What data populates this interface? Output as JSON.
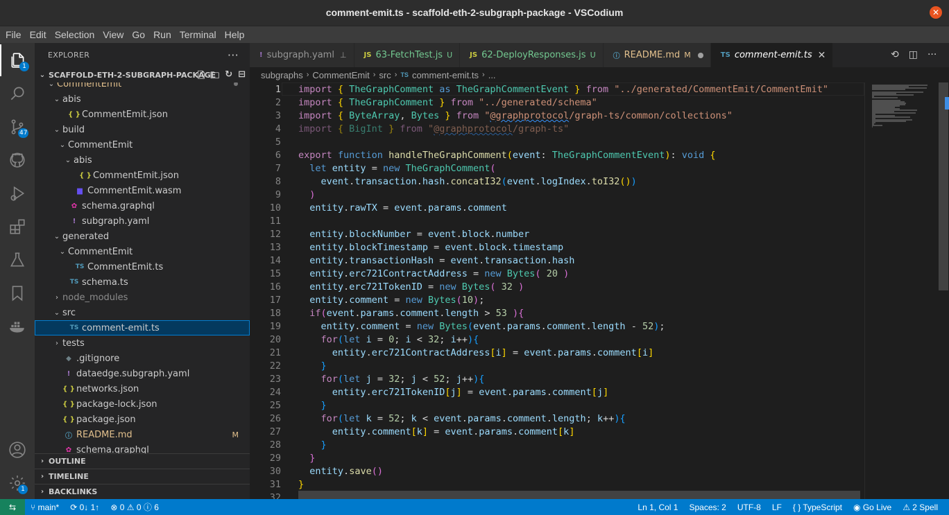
{
  "window": {
    "title": "comment-emit.ts - scaffold-eth-2-subgraph-package - VSCodium"
  },
  "menu": [
    "File",
    "Edit",
    "Selection",
    "View",
    "Go",
    "Run",
    "Terminal",
    "Help"
  ],
  "activity": {
    "explorer_badge": "1",
    "source_control_badge": "47",
    "settings_badge": "1"
  },
  "sidebar": {
    "header": "EXPLORER",
    "project": "SCAFFOLD-ETH-2-SUBGRAPH-PACKAGE",
    "tree": [
      {
        "label": "CommentEmit",
        "type": "folder-open",
        "depth": 1,
        "cls": "modified"
      },
      {
        "label": "abis",
        "type": "folder-open",
        "depth": 2
      },
      {
        "label": "CommentEmit.json",
        "type": "json",
        "depth": 3
      },
      {
        "label": "build",
        "type": "folder-open",
        "depth": 2
      },
      {
        "label": "CommentEmit",
        "type": "folder-open",
        "depth": 3
      },
      {
        "label": "abis",
        "type": "folder-open",
        "depth": 4
      },
      {
        "label": "CommentEmit.json",
        "type": "json",
        "depth": 5
      },
      {
        "label": "CommentEmit.wasm",
        "type": "wasm",
        "depth": 4
      },
      {
        "label": "schema.graphql",
        "type": "gql",
        "depth": 3
      },
      {
        "label": "subgraph.yaml",
        "type": "yaml",
        "depth": 3
      },
      {
        "label": "generated",
        "type": "folder-open",
        "depth": 2
      },
      {
        "label": "CommentEmit",
        "type": "folder-open",
        "depth": 3
      },
      {
        "label": "CommentEmit.ts",
        "type": "ts",
        "depth": 4
      },
      {
        "label": "schema.ts",
        "type": "ts",
        "depth": 3
      },
      {
        "label": "node_modules",
        "type": "folder-closed",
        "depth": 2,
        "cls": "dim"
      },
      {
        "label": "src",
        "type": "folder-open",
        "depth": 2
      },
      {
        "label": "comment-emit.ts",
        "type": "ts",
        "depth": 3,
        "selected": true
      },
      {
        "label": "tests",
        "type": "folder-closed",
        "depth": 2
      },
      {
        "label": ".gitignore",
        "type": "git",
        "depth": 2
      },
      {
        "label": "dataedge.subgraph.yaml",
        "type": "yaml",
        "depth": 2
      },
      {
        "label": "networks.json",
        "type": "json",
        "depth": 2
      },
      {
        "label": "package-lock.json",
        "type": "json",
        "depth": 2
      },
      {
        "label": "package.json",
        "type": "json",
        "depth": 2
      },
      {
        "label": "README.md",
        "type": "info",
        "depth": 2,
        "cls": "modified",
        "badge": "M"
      },
      {
        "label": "schema.graphql",
        "type": "gql",
        "depth": 2
      }
    ],
    "sections": [
      "OUTLINE",
      "TIMELINE",
      "BACKLINKS"
    ]
  },
  "tabs": [
    {
      "label": "subgraph.yaml",
      "icon": "!",
      "iconColor": "#a074c4",
      "suffix": "pin"
    },
    {
      "label": "63-FetchTest.js",
      "icon": "JS",
      "iconColor": "#cbcb41",
      "suffix": "U",
      "labelColor": "#73c991"
    },
    {
      "label": "62-DeployResponses.js",
      "icon": "JS",
      "iconColor": "#cbcb41",
      "suffix": "U",
      "labelColor": "#73c991"
    },
    {
      "label": "README.md",
      "icon": "ⓘ",
      "iconColor": "#519aba",
      "suffix": "M",
      "labelColor": "#e2c08d",
      "dot": true
    },
    {
      "label": "comment-emit.ts",
      "icon": "TS",
      "iconColor": "#519aba",
      "suffix": "x",
      "active": true
    }
  ],
  "breadcrumb": [
    "subgraphs",
    "CommentEmit",
    "src",
    "comment-emit.ts",
    "..."
  ],
  "editor": {
    "code": [
      [
        [
          "k",
          "import "
        ],
        [
          "y",
          "{ "
        ],
        [
          "t",
          "TheGraphComment"
        ],
        [
          "kb",
          " as "
        ],
        [
          "t",
          "TheGraphCommentEvent"
        ],
        [
          "y",
          " } "
        ],
        [
          "k",
          "from "
        ],
        [
          "s",
          "\"../generated/CommentEmit/CommentEmit\""
        ]
      ],
      [
        [
          "k",
          "import "
        ],
        [
          "y",
          "{ "
        ],
        [
          "t",
          "TheGraphComment"
        ],
        [
          "y",
          " } "
        ],
        [
          "k",
          "from "
        ],
        [
          "s",
          "\"../generated/schema\""
        ]
      ],
      [
        [
          "k",
          "import "
        ],
        [
          "y",
          "{ "
        ],
        [
          "t",
          "ByteArray"
        ],
        [
          "",
          "', '"
        ],
        [
          "t",
          "Bytes"
        ],
        [
          "y",
          " } "
        ],
        [
          "k",
          "from "
        ],
        [
          "s",
          "\""
        ],
        [
          "sq",
          "@graphprotocol"
        ],
        [
          "s",
          "/graph-ts/common/collections\""
        ]
      ],
      [
        [
          "fk",
          "import "
        ],
        [
          "fy",
          "{ "
        ],
        [
          "ft",
          "BigInt"
        ],
        [
          "fy",
          " } "
        ],
        [
          "fk",
          "from "
        ],
        [
          "fs",
          "\""
        ],
        [
          "fsq",
          "@graphprotocol"
        ],
        [
          "fs",
          "/graph-ts\""
        ]
      ],
      [],
      [
        [
          "k",
          "export "
        ],
        [
          "kb",
          "function "
        ],
        [
          "f",
          "handleTheGraphComment"
        ],
        [
          "y",
          "("
        ],
        [
          "v",
          "event"
        ],
        [
          "",
          ": "
        ],
        [
          "t",
          "TheGraphCommentEvent"
        ],
        [
          "y",
          ")"
        ],
        [
          "",
          ": "
        ],
        [
          "kb",
          "void "
        ],
        [
          "y",
          "{"
        ]
      ],
      [
        [
          "",
          "  "
        ],
        [
          "kb",
          "let "
        ],
        [
          "v",
          "entity"
        ],
        [
          "",
          " = "
        ],
        [
          "kb",
          "new "
        ],
        [
          "t",
          "TheGraphComment"
        ],
        [
          "p",
          "("
        ]
      ],
      [
        [
          "",
          "    "
        ],
        [
          "v",
          "event"
        ],
        [
          "",
          "."
        ],
        [
          "v",
          "transaction"
        ],
        [
          "",
          "."
        ],
        [
          "v",
          "hash"
        ],
        [
          "",
          "."
        ],
        [
          "f",
          "concatI32"
        ],
        [
          "b",
          "("
        ],
        [
          "v",
          "event"
        ],
        [
          "",
          "."
        ],
        [
          "v",
          "logIndex"
        ],
        [
          "",
          "."
        ],
        [
          "f",
          "toI32"
        ],
        [
          "y",
          "()"
        ],
        [
          "b",
          ")"
        ]
      ],
      [
        [
          "",
          "  "
        ],
        [
          "p",
          ")"
        ]
      ],
      [
        [
          "",
          "  "
        ],
        [
          "v",
          "entity"
        ],
        [
          "",
          "."
        ],
        [
          "v",
          "rawTX"
        ],
        [
          "",
          " = "
        ],
        [
          "v",
          "event"
        ],
        [
          "",
          "."
        ],
        [
          "v",
          "params"
        ],
        [
          "",
          "."
        ],
        [
          "v",
          "comment"
        ]
      ],
      [],
      [
        [
          "",
          "  "
        ],
        [
          "v",
          "entity"
        ],
        [
          "",
          "."
        ],
        [
          "v",
          "blockNumber"
        ],
        [
          "",
          " = "
        ],
        [
          "v",
          "event"
        ],
        [
          "",
          "."
        ],
        [
          "v",
          "block"
        ],
        [
          "",
          "."
        ],
        [
          "v",
          "number"
        ]
      ],
      [
        [
          "",
          "  "
        ],
        [
          "v",
          "entity"
        ],
        [
          "",
          "."
        ],
        [
          "v",
          "blockTimestamp"
        ],
        [
          "",
          " = "
        ],
        [
          "v",
          "event"
        ],
        [
          "",
          "."
        ],
        [
          "v",
          "block"
        ],
        [
          "",
          "."
        ],
        [
          "v",
          "timestamp"
        ]
      ],
      [
        [
          "",
          "  "
        ],
        [
          "v",
          "entity"
        ],
        [
          "",
          "."
        ],
        [
          "v",
          "transactionHash"
        ],
        [
          "",
          " = "
        ],
        [
          "v",
          "event"
        ],
        [
          "",
          "."
        ],
        [
          "v",
          "transaction"
        ],
        [
          "",
          "."
        ],
        [
          "v",
          "hash"
        ]
      ],
      [
        [
          "",
          "  "
        ],
        [
          "v",
          "entity"
        ],
        [
          "",
          "."
        ],
        [
          "v",
          "erc721ContractAddress"
        ],
        [
          "",
          " = "
        ],
        [
          "kb",
          "new "
        ],
        [
          "t",
          "Bytes"
        ],
        [
          "p",
          "( "
        ],
        [
          "n",
          "20"
        ],
        [
          "p",
          " )"
        ]
      ],
      [
        [
          "",
          "  "
        ],
        [
          "v",
          "entity"
        ],
        [
          "",
          "."
        ],
        [
          "v",
          "erc721TokenID"
        ],
        [
          "",
          " = "
        ],
        [
          "kb",
          "new "
        ],
        [
          "t",
          "Bytes"
        ],
        [
          "p",
          "( "
        ],
        [
          "n",
          "32"
        ],
        [
          "p",
          " )"
        ]
      ],
      [
        [
          "",
          "  "
        ],
        [
          "v",
          "entity"
        ],
        [
          "",
          "."
        ],
        [
          "v",
          "comment"
        ],
        [
          "",
          " = "
        ],
        [
          "kb",
          "new "
        ],
        [
          "t",
          "Bytes"
        ],
        [
          "p",
          "("
        ],
        [
          "n",
          "10"
        ],
        [
          "p",
          ")"
        ],
        [
          "",
          ";"
        ]
      ],
      [
        [
          "",
          "  "
        ],
        [
          "k",
          "if"
        ],
        [
          "p",
          "("
        ],
        [
          "v",
          "event"
        ],
        [
          "",
          "."
        ],
        [
          "v",
          "params"
        ],
        [
          "",
          "."
        ],
        [
          "v",
          "comment"
        ],
        [
          "",
          "."
        ],
        [
          "v",
          "length"
        ],
        [
          "",
          " > "
        ],
        [
          "n",
          "53"
        ],
        [
          "p",
          " )"
        ],
        [
          "p",
          "{"
        ]
      ],
      [
        [
          "",
          "    "
        ],
        [
          "v",
          "entity"
        ],
        [
          "",
          "."
        ],
        [
          "v",
          "comment"
        ],
        [
          "",
          " = "
        ],
        [
          "kb",
          "new "
        ],
        [
          "t",
          "Bytes"
        ],
        [
          "b",
          "("
        ],
        [
          "v",
          "event"
        ],
        [
          "",
          "."
        ],
        [
          "v",
          "params"
        ],
        [
          "",
          "."
        ],
        [
          "v",
          "comment"
        ],
        [
          "",
          "."
        ],
        [
          "v",
          "length"
        ],
        [
          "",
          " - "
        ],
        [
          "n",
          "52"
        ],
        [
          "b",
          ")"
        ],
        [
          "",
          ";"
        ]
      ],
      [
        [
          "",
          "    "
        ],
        [
          "k",
          "for"
        ],
        [
          "b",
          "("
        ],
        [
          "kb",
          "let "
        ],
        [
          "v",
          "i"
        ],
        [
          "",
          " = "
        ],
        [
          "n",
          "0"
        ],
        [
          "",
          "; "
        ],
        [
          "v",
          "i"
        ],
        [
          "",
          " < "
        ],
        [
          "n",
          "32"
        ],
        [
          "",
          "; "
        ],
        [
          "v",
          "i"
        ],
        [
          "",
          "++"
        ],
        [
          "b",
          ")"
        ],
        [
          "b",
          "{"
        ]
      ],
      [
        [
          "",
          "      "
        ],
        [
          "v",
          "entity"
        ],
        [
          "",
          "."
        ],
        [
          "v",
          "erc721ContractAddress"
        ],
        [
          "y",
          "["
        ],
        [
          "v",
          "i"
        ],
        [
          "y",
          "]"
        ],
        [
          "",
          " = "
        ],
        [
          "v",
          "event"
        ],
        [
          "",
          "."
        ],
        [
          "v",
          "params"
        ],
        [
          "",
          "."
        ],
        [
          "v",
          "comment"
        ],
        [
          "y",
          "["
        ],
        [
          "v",
          "i"
        ],
        [
          "y",
          "]"
        ]
      ],
      [
        [
          "",
          "    "
        ],
        [
          "b",
          "}"
        ]
      ],
      [
        [
          "",
          "    "
        ],
        [
          "k",
          "for"
        ],
        [
          "b",
          "("
        ],
        [
          "kb",
          "let "
        ],
        [
          "v",
          "j"
        ],
        [
          "",
          " = "
        ],
        [
          "n",
          "32"
        ],
        [
          "",
          "; "
        ],
        [
          "v",
          "j"
        ],
        [
          "",
          " < "
        ],
        [
          "n",
          "52"
        ],
        [
          "",
          "; "
        ],
        [
          "v",
          "j"
        ],
        [
          "",
          "++"
        ],
        [
          "b",
          ")"
        ],
        [
          "b",
          "{"
        ]
      ],
      [
        [
          "",
          "      "
        ],
        [
          "v",
          "entity"
        ],
        [
          "",
          "."
        ],
        [
          "v",
          "erc721TokenID"
        ],
        [
          "y",
          "["
        ],
        [
          "v",
          "j"
        ],
        [
          "y",
          "]"
        ],
        [
          "",
          " = "
        ],
        [
          "v",
          "event"
        ],
        [
          "",
          "."
        ],
        [
          "v",
          "params"
        ],
        [
          "",
          "."
        ],
        [
          "v",
          "comment"
        ],
        [
          "y",
          "["
        ],
        [
          "v",
          "j"
        ],
        [
          "y",
          "]"
        ]
      ],
      [
        [
          "",
          "    "
        ],
        [
          "b",
          "}"
        ]
      ],
      [
        [
          "",
          "    "
        ],
        [
          "k",
          "for"
        ],
        [
          "b",
          "("
        ],
        [
          "kb",
          "let "
        ],
        [
          "v",
          "k"
        ],
        [
          "",
          " = "
        ],
        [
          "n",
          "52"
        ],
        [
          "",
          "; "
        ],
        [
          "v",
          "k"
        ],
        [
          "",
          " < "
        ],
        [
          "v",
          "event"
        ],
        [
          "",
          "."
        ],
        [
          "v",
          "params"
        ],
        [
          "",
          "."
        ],
        [
          "v",
          "comment"
        ],
        [
          "",
          "."
        ],
        [
          "v",
          "length"
        ],
        [
          "",
          "; "
        ],
        [
          "v",
          "k"
        ],
        [
          "",
          "++"
        ],
        [
          "b",
          ")"
        ],
        [
          "b",
          "{"
        ]
      ],
      [
        [
          "",
          "      "
        ],
        [
          "v",
          "entity"
        ],
        [
          "",
          "."
        ],
        [
          "v",
          "comment"
        ],
        [
          "y",
          "["
        ],
        [
          "v",
          "k"
        ],
        [
          "y",
          "]"
        ],
        [
          "",
          " = "
        ],
        [
          "v",
          "event"
        ],
        [
          "",
          "."
        ],
        [
          "v",
          "params"
        ],
        [
          "",
          "."
        ],
        [
          "v",
          "comment"
        ],
        [
          "y",
          "["
        ],
        [
          "v",
          "k"
        ],
        [
          "y",
          "]"
        ]
      ],
      [
        [
          "",
          "    "
        ],
        [
          "b",
          "}"
        ]
      ],
      [
        [
          "",
          "  "
        ],
        [
          "p",
          "}"
        ]
      ],
      [
        [
          "",
          "  "
        ],
        [
          "v",
          "entity"
        ],
        [
          "",
          "."
        ],
        [
          "f",
          "save"
        ],
        [
          "p",
          "()"
        ]
      ],
      [
        [
          "y",
          "}"
        ]
      ],
      [
        [
          "",
          "32"
        ]
      ]
    ]
  },
  "statusbar": {
    "branch": "main*",
    "sync": "0↓ 1↑",
    "errors": "0",
    "warnings": "0",
    "info": "6",
    "position": "Ln 1, Col 1",
    "spaces": "Spaces: 2",
    "encoding": "UTF-8",
    "eol": "LF",
    "language": "TypeScript",
    "golive": "Go Live",
    "spell": "2 Spell"
  }
}
